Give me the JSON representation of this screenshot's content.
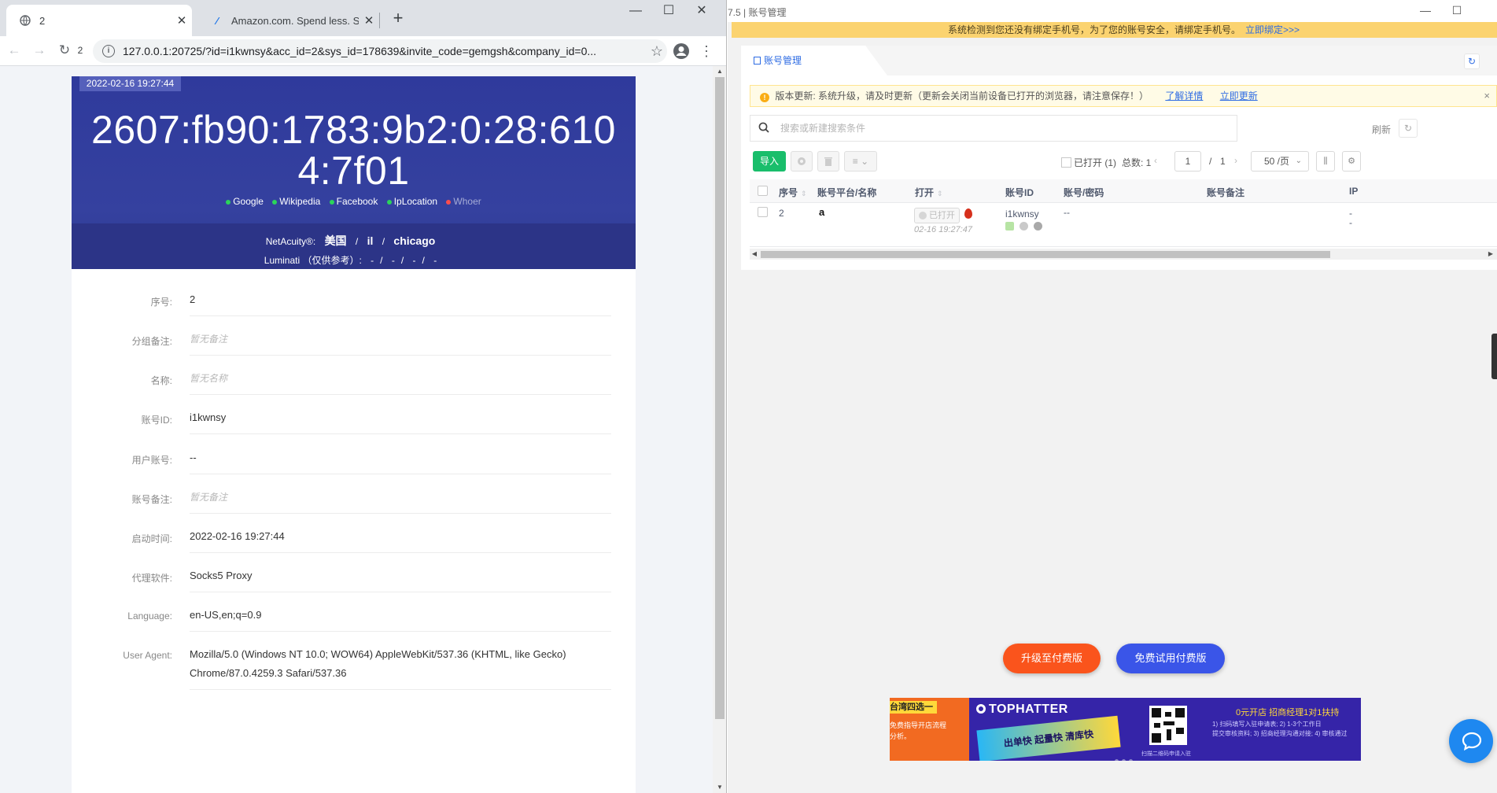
{
  "chrome": {
    "tabs": [
      {
        "title": "2",
        "active": true
      },
      {
        "title": "Amazon.com. Spend less. Smile more.",
        "active": false
      }
    ],
    "window_buttons": [
      "—",
      "☐",
      "✕"
    ],
    "toolbar": {
      "reload_badge": "2",
      "url": "127.0.0.1:20725/?id=i1kwnsy&acc_id=2&sys_id=178639&invite_code=gemgsh&company_id=0..."
    }
  },
  "page": {
    "timestamp": "2022-02-16 19:27:44",
    "ip": "2607:fb90:1783:9b2:0:28:6104:7f01",
    "links": [
      {
        "label": "Google",
        "status": "green"
      },
      {
        "label": "Wikipedia",
        "status": "green"
      },
      {
        "label": "Facebook",
        "status": "green"
      },
      {
        "label": "IpLocation",
        "status": "green"
      },
      {
        "label": "Whoer",
        "status": "red"
      }
    ],
    "netacuity": {
      "label": "NetAcuity®:",
      "country": "美国",
      "region": "il",
      "city": "chicago",
      "sep": "/"
    },
    "luminati": {
      "label": "Luminati （仅供参考）:",
      "values": [
        "-",
        "-",
        "-",
        "-"
      ],
      "sep": "/"
    },
    "fields": [
      {
        "label": "序号:",
        "value": "2",
        "placeholder": false
      },
      {
        "label": "分组备注:",
        "value": "暂无备注",
        "placeholder": true
      },
      {
        "label": "名称:",
        "value": "暂无名称",
        "placeholder": true
      },
      {
        "label": "账号ID:",
        "value": "i1kwnsy",
        "placeholder": false
      },
      {
        "label": "用户账号:",
        "value": "--",
        "placeholder": false
      },
      {
        "label": "账号备注:",
        "value": "暂无备注",
        "placeholder": true
      },
      {
        "label": "启动时间:",
        "value": "2022-02-16 19:27:44",
        "placeholder": false
      },
      {
        "label": "代理软件:",
        "value": "Socks5 Proxy",
        "placeholder": false
      },
      {
        "label": "Language:",
        "value": "en-US,en;q=0.9",
        "placeholder": false
      },
      {
        "label": "User Agent:",
        "value": "Mozilla/5.0 (Windows NT 10.0; WOW64) AppleWebKit/537.36 (KHTML, like Gecko) Chrome/87.0.4259.3 Safari/537.36",
        "placeholder": false
      }
    ]
  },
  "app": {
    "title": "7.5 | 账号管理",
    "notice": {
      "text": "系统检测到您还没有绑定手机号，为了您的账号安全，请绑定手机号。",
      "link": "立即绑定>>>"
    },
    "tab_label": "账号管理",
    "update_bar": {
      "text": "版本更新: 系统升级，请及时更新（更新会关闭当前设备已打开的浏览器，请注意保存！）",
      "learn_more": "了解详情",
      "update_now": "立即更新",
      "close": "×"
    },
    "search_placeholder": "搜索或新建搜索条件",
    "refresh_label": "刷新",
    "import_label": "导入",
    "opened_filter": "已打开 (1)",
    "total_label": "总数: 1",
    "pager": {
      "current": "1",
      "sep": "/",
      "total": "1",
      "prev": "‹",
      "next": "›"
    },
    "per_page": "50 /页",
    "columns": [
      "序号",
      "账号平台/名称",
      "打开",
      "账号ID",
      "账号/密码",
      "账号备注",
      "IP"
    ],
    "rows": [
      {
        "index": "2",
        "platform_icon": "amazon-icon",
        "platform_glyph": "a",
        "open_label": "已打开",
        "open_time": "02-16 19:27:47",
        "account_id": "i1kwnsy",
        "credentials": "--",
        "remark": "",
        "ip_line1": "-",
        "ip_line2": "-"
      }
    ],
    "upgrade_button": "升级至付费版",
    "trial_button": "免费试用付费版",
    "ad": {
      "left_tag": "台湾四选一",
      "left_lines": [
        "免费指导开店流程",
        "分析。"
      ],
      "brand": "TOPHATTER",
      "promo": "出单快 起量快 清库快",
      "qr_caption": "扫描二维码申请入驻",
      "headline": "0元开店 招商经理1对1扶持",
      "details": [
        "1) 扫码填写入驻申请表; 2) 1-3个工作日",
        "提交审核资料; 3) 招商经理沟通对接; 4) 审核通过"
      ]
    },
    "colors": {
      "accent": "#2d6be3",
      "import": "#19be6b",
      "upgrade": "#fa541c",
      "trial": "#3a55e8",
      "banner": "#2f3a9c",
      "notice": "#fbd370"
    }
  }
}
